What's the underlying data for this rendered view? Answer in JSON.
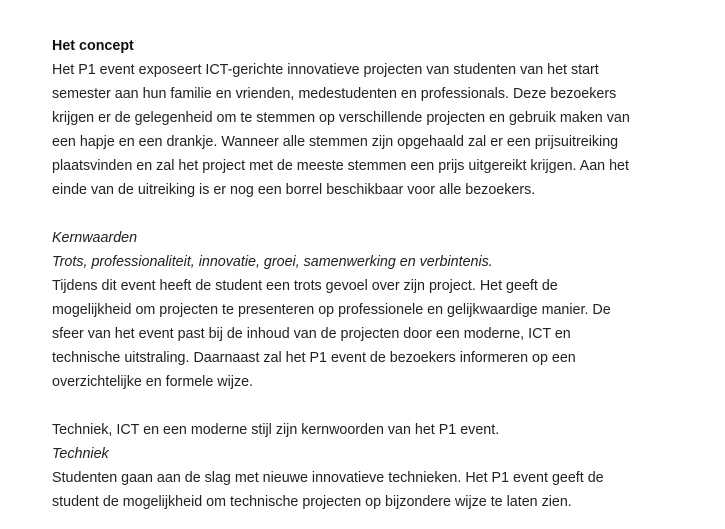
{
  "concept": {
    "heading": "Het concept",
    "lines": [
      "Het P1 event exposeert ICT-gerichte innovatieve projecten van studenten van het start",
      "semester aan hun familie en vrienden, medestudenten en professionals. Deze bezoekers",
      "krijgen er de gelegenheid om te stemmen op verschillende projecten en gebruik maken van",
      "een hapje en een drankje. Wanneer alle stemmen zijn opgehaald zal er een prijsuitreiking",
      "plaatsvinden en zal het project met de meeste stemmen een prijs uitgereikt krijgen. Aan het",
      "einde van de uitreiking is er nog een borrel beschikbaar voor alle bezoekers."
    ]
  },
  "kernwaarden": {
    "heading": "Kernwaarden",
    "subheading": "Trots, professionaliteit, innovatie, groei, samenwerking en verbintenis.",
    "lines": [
      "Tijdens dit event heeft de student een trots gevoel over zijn project. Het geeft de",
      "mogelijkheid om projecten te presenteren op professionele en gelijkwaardige manier. De",
      "sfeer van het event past bij de inhoud van de projecten door een moderne, ICT en",
      "technische uitstraling. Daarnaast zal het P1 event de bezoekers informeren op een",
      "overzichtelijke en formele wijze."
    ]
  },
  "techniek": {
    "intro": "Techniek, ICT en een moderne stijl zijn kernwoorden van het P1 event.",
    "heading": "Techniek",
    "lines": [
      "Studenten gaan aan de slag met nieuwe innovatieve technieken. Het P1 event geeft de",
      "student de mogelijkheid om technische projecten op bijzondere wijze te laten zien."
    ]
  }
}
